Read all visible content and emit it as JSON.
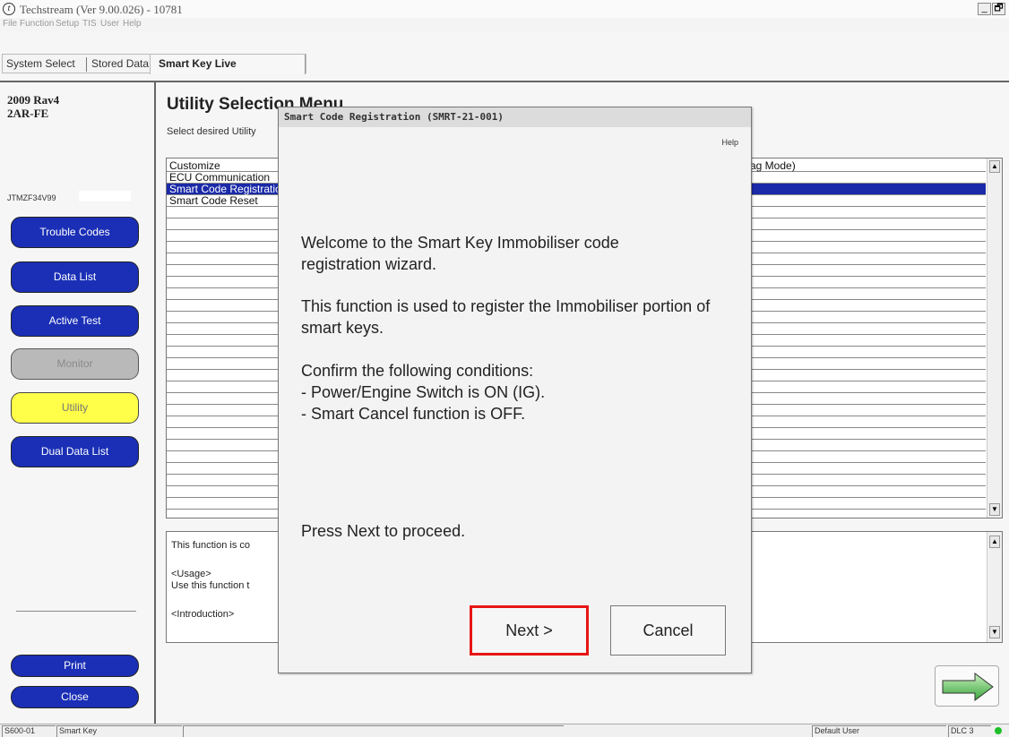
{
  "window": {
    "title": "Techstream (Ver 9.00.026) - 10781",
    "minimize": "_",
    "restore": "🗗"
  },
  "menu": [
    "File",
    "Function",
    "Setup",
    "TIS",
    "User",
    "Help"
  ],
  "tabs": {
    "system_select": "System Select",
    "stored_data": "Stored Data",
    "smart_key_live": "Smart Key Live"
  },
  "vehicle": {
    "model": "2009 Rav4",
    "engine": "2AR-FE",
    "vin": "JTMZF34V99"
  },
  "sidebar": {
    "trouble_codes": "Trouble Codes",
    "data_list": "Data List",
    "active_test": "Active Test",
    "monitor": "Monitor",
    "utility": "Utility",
    "dual_data_list": "Dual Data List",
    "print": "Print",
    "close": "Close"
  },
  "main": {
    "title": "Utility Selection Menu",
    "subtitle": "Select desired Utility",
    "list_items": [
      "Customize",
      "ECU Communication",
      "Smart Code Registration",
      "Smart Code Reset"
    ],
    "selected_index": 2,
    "right_column_text": "ag Mode)",
    "description": [
      "This function is co",
      "<Usage>",
      "Use this function t",
      "<Introduction>"
    ]
  },
  "dialog": {
    "title": "Smart Code Registration (SMRT-21-001)",
    "help": "Help",
    "para1": "Welcome to the Smart Key Immobiliser code registration wizard.",
    "para2": "This function is used to register the Immobiliser portion of smart keys.",
    "para3_heading": "Confirm the following conditions:",
    "cond1": "- Power/Engine Switch is ON (IG).",
    "cond2": "- Smart Cancel function is OFF.",
    "proceed": "Press Next to proceed.",
    "next": "Next >",
    "cancel": "Cancel",
    "highlight_color": "#e81515"
  },
  "status": {
    "code": "S600-01",
    "system": "Smart Key",
    "user": "Default User",
    "port": "DLC 3",
    "indicator_color": "#1fbf2a"
  }
}
